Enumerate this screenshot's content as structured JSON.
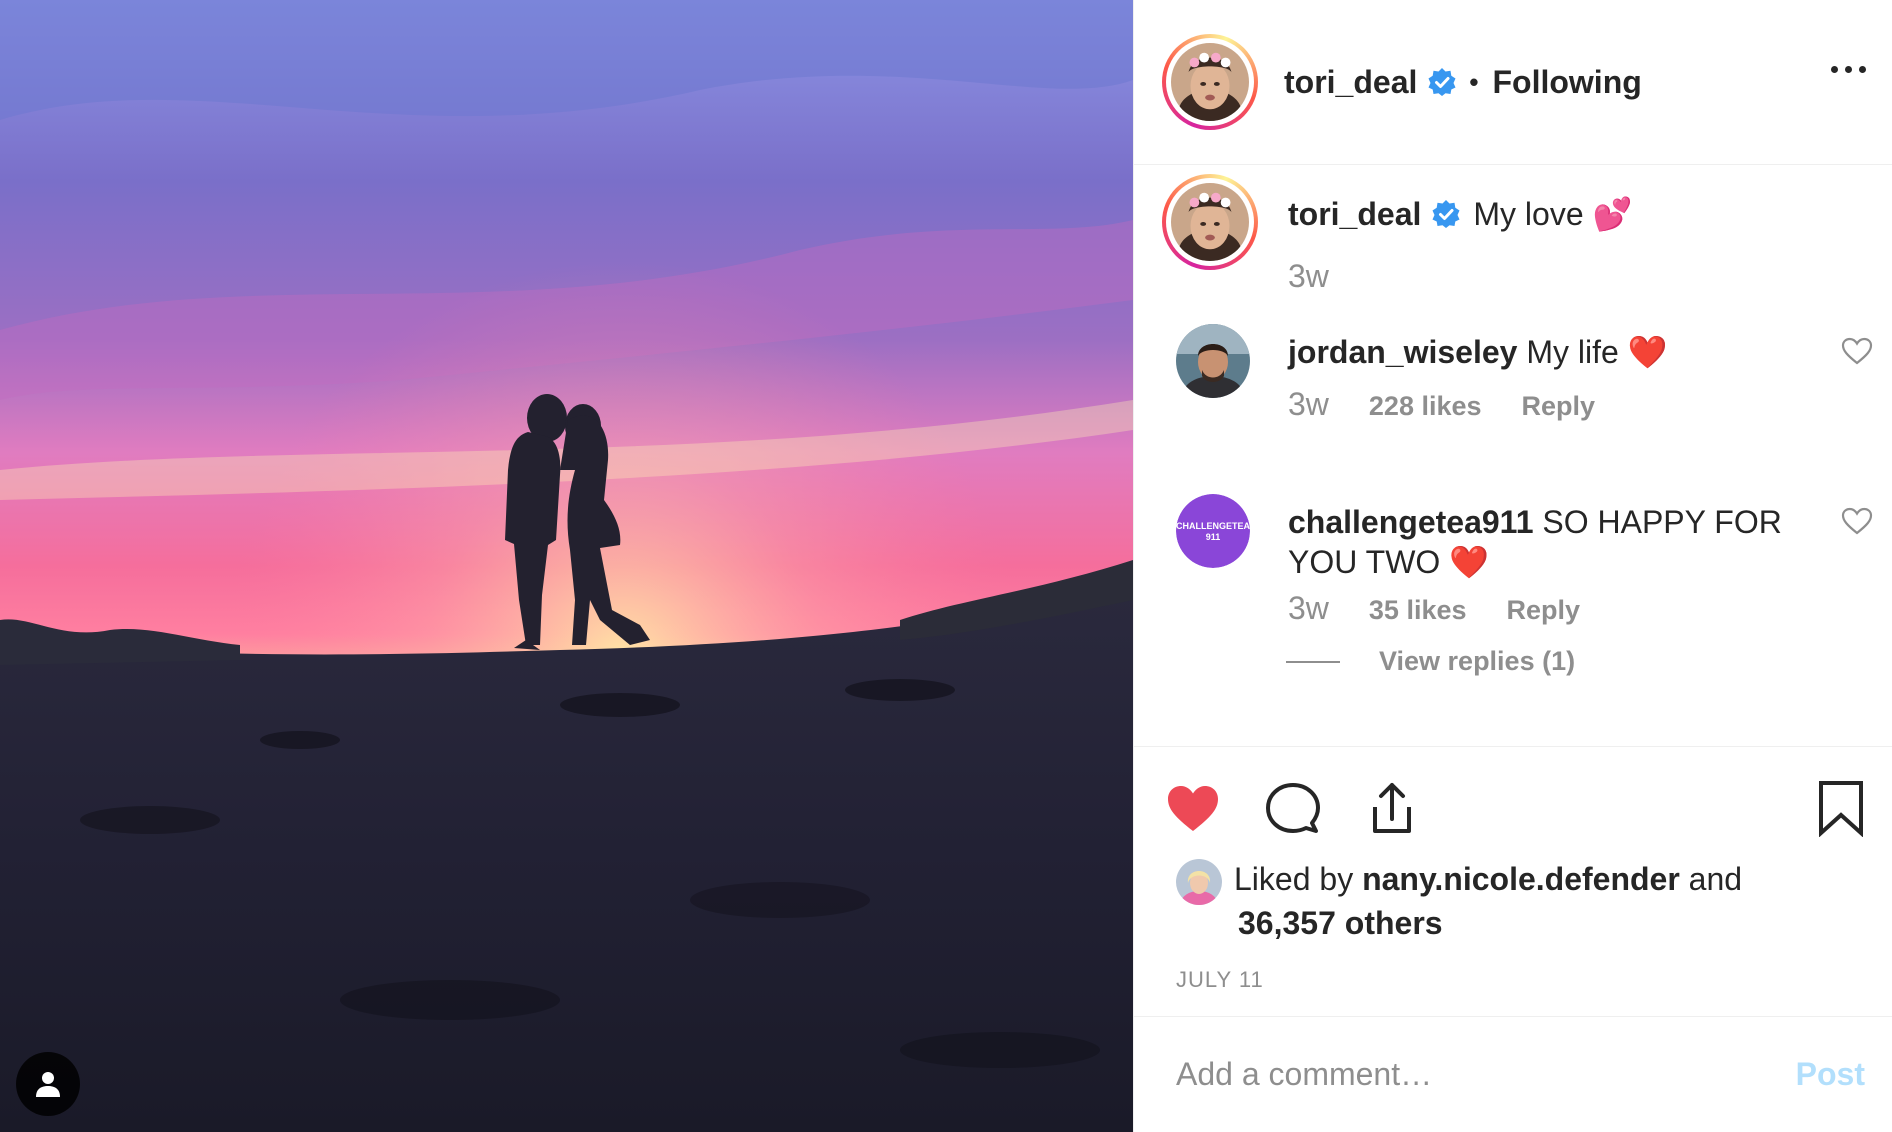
{
  "header": {
    "username": "tori_deal",
    "separator": "•",
    "follow_status": "Following"
  },
  "caption": {
    "username": "tori_deal",
    "text": "My love",
    "emoji": "💕",
    "time": "3w"
  },
  "comments": [
    {
      "username": "jordan_wiseley",
      "text": "My life",
      "emoji": "❤️",
      "time": "3w",
      "likes": "228 likes",
      "reply_label": "Reply"
    },
    {
      "username": "challengetea911",
      "text": "SO HAPPY FOR YOU TWO",
      "emoji": "❤️",
      "time": "3w",
      "likes": "35 likes",
      "reply_label": "Reply",
      "avatar_text_line1": "CHALLENGETEA",
      "avatar_text_line2": "911",
      "view_replies": "View replies (1)"
    }
  ],
  "likes": {
    "prefix": "Liked by",
    "user": "nany.nicole.defender",
    "middle": "and",
    "others": "36,357 others"
  },
  "date": "JULY 11",
  "comment_box": {
    "placeholder": "Add a comment…",
    "post_label": "Post"
  },
  "colors": {
    "like_red": "#ed4956",
    "verified_blue": "#3897f0",
    "post_disabled": "#b2dffc"
  }
}
